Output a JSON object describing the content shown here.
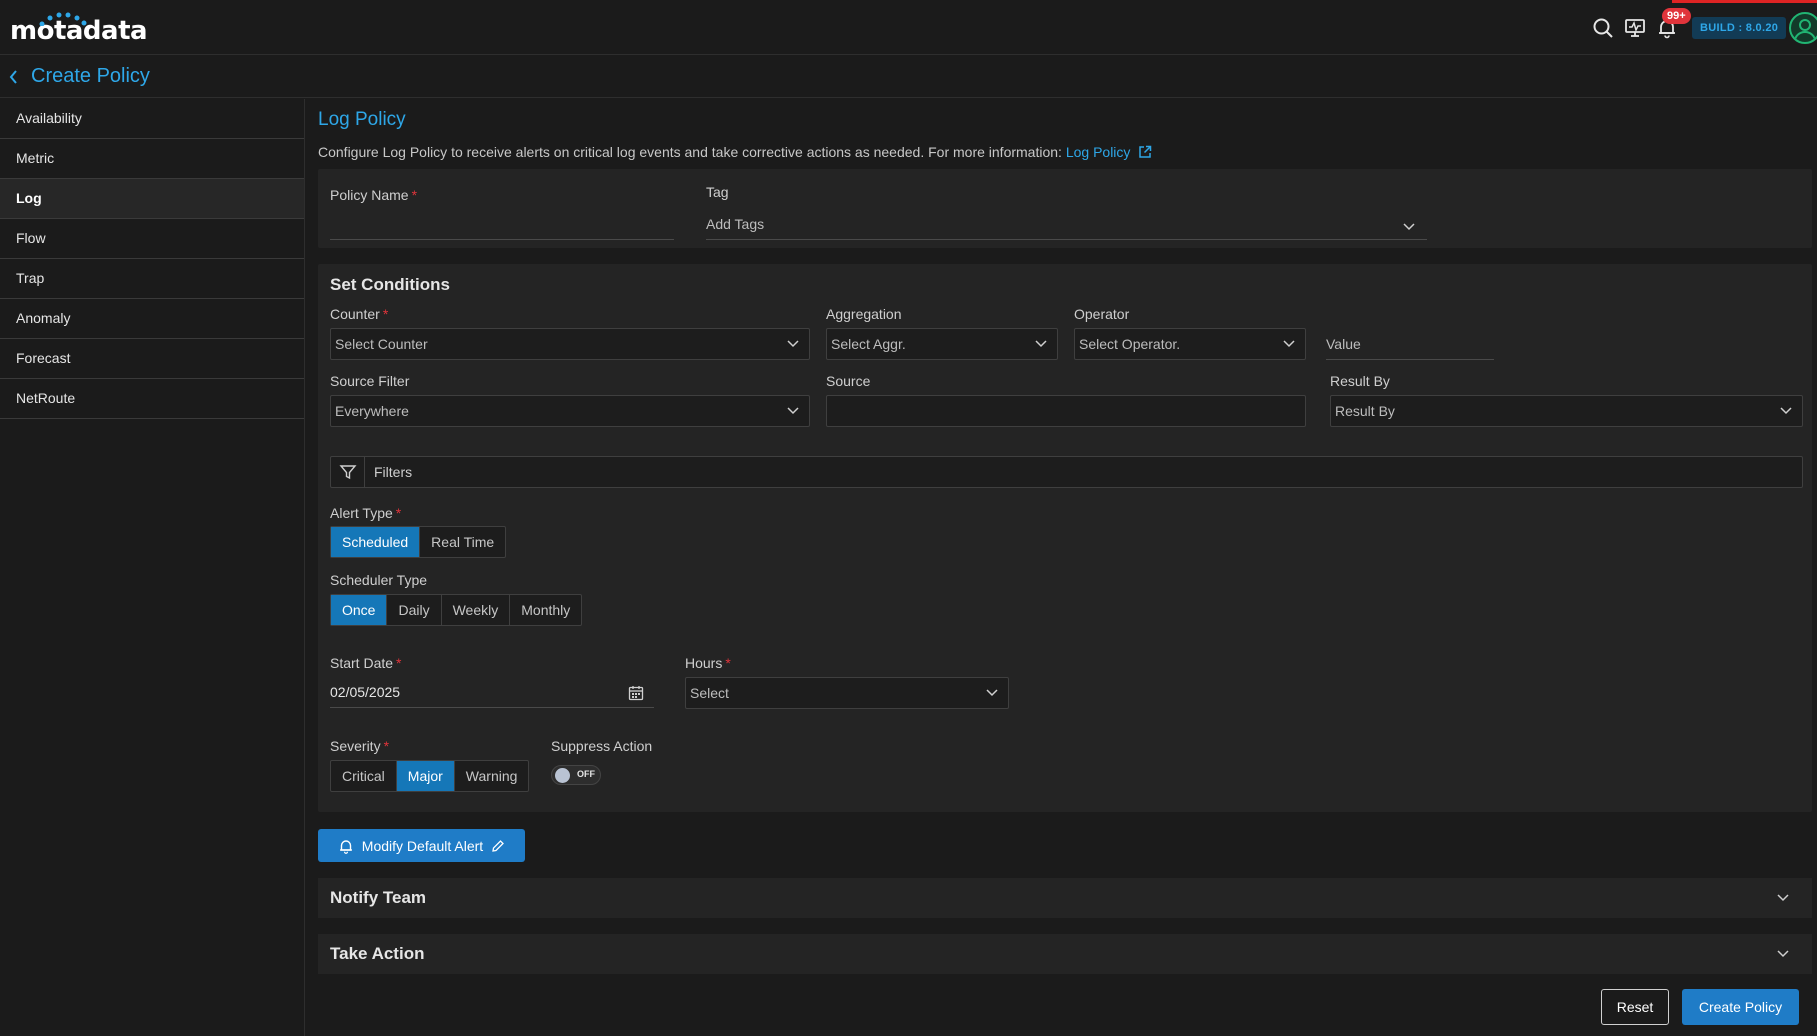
{
  "app": {
    "logo_text": "motadata",
    "notifications_badge": "99+",
    "build_label": "BUILD : 8.0.20"
  },
  "header": {
    "title": "Create Policy"
  },
  "sidebar": {
    "items": [
      {
        "label": "Availability"
      },
      {
        "label": "Metric"
      },
      {
        "label": "Log"
      },
      {
        "label": "Flow"
      },
      {
        "label": "Trap"
      },
      {
        "label": "Anomaly"
      },
      {
        "label": "Forecast"
      },
      {
        "label": "NetRoute"
      }
    ],
    "active": "Log"
  },
  "main": {
    "title": "Log Policy",
    "description": "Configure Log Policy to receive alerts on critical log events and take corrective actions as needed. For more information:",
    "description_link": "Log Policy",
    "policy_name_label": "Policy Name",
    "policy_name_value": "",
    "tag_label": "Tag",
    "tag_placeholder": "Add Tags",
    "conditions": {
      "title": "Set Conditions",
      "counter_label": "Counter",
      "counter_value": "Select Counter",
      "aggregation_label": "Aggregation",
      "aggregation_value": "Select Aggr.",
      "operator_label": "Operator",
      "operator_value": "Select Operator.",
      "value_label": "Value",
      "source_filter_label": "Source Filter",
      "source_filter_value": "Everywhere",
      "source_label": "Source",
      "source_value": "",
      "result_by_label": "Result By",
      "result_by_value": "Result By",
      "filters_label": "Filters",
      "alert_type_label": "Alert Type",
      "alert_types": [
        "Scheduled",
        "Real Time"
      ],
      "alert_type_selected": "Scheduled",
      "scheduler_type_label": "Scheduler Type",
      "scheduler_types": [
        "Once",
        "Daily",
        "Weekly",
        "Monthly"
      ],
      "scheduler_type_selected": "Once",
      "start_date_label": "Start Date",
      "start_date_value": "02/05/2025",
      "hours_label": "Hours",
      "hours_value": "Select",
      "severity_label": "Severity",
      "severities": [
        "Critical",
        "Major",
        "Warning"
      ],
      "severity_selected": "Major",
      "suppress_action_label": "Suppress Action",
      "suppress_action_state": "OFF"
    },
    "modify_alert_label": "Modify Default Alert",
    "notify_team_label": "Notify Team",
    "take_action_label": "Take Action",
    "reset_label": "Reset",
    "create_label": "Create Policy"
  },
  "colors": {
    "accent": "#2ea7e8",
    "primary_button": "#1f7cc7",
    "selected_segment": "#1577b8",
    "required": "#e0343b",
    "background": "#1b1b1b",
    "panel": "#242424"
  }
}
